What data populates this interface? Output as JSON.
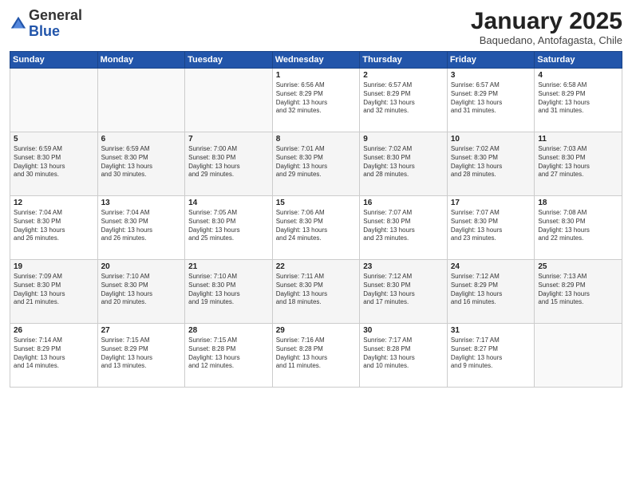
{
  "logo": {
    "general": "General",
    "blue": "Blue"
  },
  "header": {
    "title": "January 2025",
    "subtitle": "Baquedano, Antofagasta, Chile"
  },
  "weekdays": [
    "Sunday",
    "Monday",
    "Tuesday",
    "Wednesday",
    "Thursday",
    "Friday",
    "Saturday"
  ],
  "weeks": [
    [
      {
        "day": "",
        "info": ""
      },
      {
        "day": "",
        "info": ""
      },
      {
        "day": "",
        "info": ""
      },
      {
        "day": "1",
        "info": "Sunrise: 6:56 AM\nSunset: 8:29 PM\nDaylight: 13 hours\nand 32 minutes."
      },
      {
        "day": "2",
        "info": "Sunrise: 6:57 AM\nSunset: 8:29 PM\nDaylight: 13 hours\nand 32 minutes."
      },
      {
        "day": "3",
        "info": "Sunrise: 6:57 AM\nSunset: 8:29 PM\nDaylight: 13 hours\nand 31 minutes."
      },
      {
        "day": "4",
        "info": "Sunrise: 6:58 AM\nSunset: 8:29 PM\nDaylight: 13 hours\nand 31 minutes."
      }
    ],
    [
      {
        "day": "5",
        "info": "Sunrise: 6:59 AM\nSunset: 8:30 PM\nDaylight: 13 hours\nand 30 minutes."
      },
      {
        "day": "6",
        "info": "Sunrise: 6:59 AM\nSunset: 8:30 PM\nDaylight: 13 hours\nand 30 minutes."
      },
      {
        "day": "7",
        "info": "Sunrise: 7:00 AM\nSunset: 8:30 PM\nDaylight: 13 hours\nand 29 minutes."
      },
      {
        "day": "8",
        "info": "Sunrise: 7:01 AM\nSunset: 8:30 PM\nDaylight: 13 hours\nand 29 minutes."
      },
      {
        "day": "9",
        "info": "Sunrise: 7:02 AM\nSunset: 8:30 PM\nDaylight: 13 hours\nand 28 minutes."
      },
      {
        "day": "10",
        "info": "Sunrise: 7:02 AM\nSunset: 8:30 PM\nDaylight: 13 hours\nand 28 minutes."
      },
      {
        "day": "11",
        "info": "Sunrise: 7:03 AM\nSunset: 8:30 PM\nDaylight: 13 hours\nand 27 minutes."
      }
    ],
    [
      {
        "day": "12",
        "info": "Sunrise: 7:04 AM\nSunset: 8:30 PM\nDaylight: 13 hours\nand 26 minutes."
      },
      {
        "day": "13",
        "info": "Sunrise: 7:04 AM\nSunset: 8:30 PM\nDaylight: 13 hours\nand 26 minutes."
      },
      {
        "day": "14",
        "info": "Sunrise: 7:05 AM\nSunset: 8:30 PM\nDaylight: 13 hours\nand 25 minutes."
      },
      {
        "day": "15",
        "info": "Sunrise: 7:06 AM\nSunset: 8:30 PM\nDaylight: 13 hours\nand 24 minutes."
      },
      {
        "day": "16",
        "info": "Sunrise: 7:07 AM\nSunset: 8:30 PM\nDaylight: 13 hours\nand 23 minutes."
      },
      {
        "day": "17",
        "info": "Sunrise: 7:07 AM\nSunset: 8:30 PM\nDaylight: 13 hours\nand 23 minutes."
      },
      {
        "day": "18",
        "info": "Sunrise: 7:08 AM\nSunset: 8:30 PM\nDaylight: 13 hours\nand 22 minutes."
      }
    ],
    [
      {
        "day": "19",
        "info": "Sunrise: 7:09 AM\nSunset: 8:30 PM\nDaylight: 13 hours\nand 21 minutes."
      },
      {
        "day": "20",
        "info": "Sunrise: 7:10 AM\nSunset: 8:30 PM\nDaylight: 13 hours\nand 20 minutes."
      },
      {
        "day": "21",
        "info": "Sunrise: 7:10 AM\nSunset: 8:30 PM\nDaylight: 13 hours\nand 19 minutes."
      },
      {
        "day": "22",
        "info": "Sunrise: 7:11 AM\nSunset: 8:30 PM\nDaylight: 13 hours\nand 18 minutes."
      },
      {
        "day": "23",
        "info": "Sunrise: 7:12 AM\nSunset: 8:30 PM\nDaylight: 13 hours\nand 17 minutes."
      },
      {
        "day": "24",
        "info": "Sunrise: 7:12 AM\nSunset: 8:29 PM\nDaylight: 13 hours\nand 16 minutes."
      },
      {
        "day": "25",
        "info": "Sunrise: 7:13 AM\nSunset: 8:29 PM\nDaylight: 13 hours\nand 15 minutes."
      }
    ],
    [
      {
        "day": "26",
        "info": "Sunrise: 7:14 AM\nSunset: 8:29 PM\nDaylight: 13 hours\nand 14 minutes."
      },
      {
        "day": "27",
        "info": "Sunrise: 7:15 AM\nSunset: 8:29 PM\nDaylight: 13 hours\nand 13 minutes."
      },
      {
        "day": "28",
        "info": "Sunrise: 7:15 AM\nSunset: 8:28 PM\nDaylight: 13 hours\nand 12 minutes."
      },
      {
        "day": "29",
        "info": "Sunrise: 7:16 AM\nSunset: 8:28 PM\nDaylight: 13 hours\nand 11 minutes."
      },
      {
        "day": "30",
        "info": "Sunrise: 7:17 AM\nSunset: 8:28 PM\nDaylight: 13 hours\nand 10 minutes."
      },
      {
        "day": "31",
        "info": "Sunrise: 7:17 AM\nSunset: 8:27 PM\nDaylight: 13 hours\nand 9 minutes."
      },
      {
        "day": "",
        "info": ""
      }
    ]
  ]
}
